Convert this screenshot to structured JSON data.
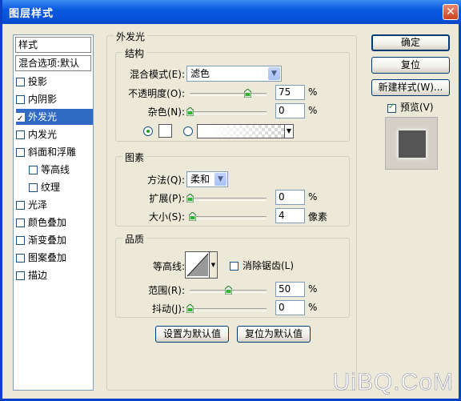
{
  "window": {
    "title": "图层样式"
  },
  "left_panel": {
    "header_styles": "样式",
    "header_blend": "混合选项:默认",
    "items": [
      {
        "label": "投影",
        "checked": false,
        "selected": false,
        "indent": false
      },
      {
        "label": "内阴影",
        "checked": false,
        "selected": false,
        "indent": false
      },
      {
        "label": "外发光",
        "checked": true,
        "selected": true,
        "indent": false
      },
      {
        "label": "内发光",
        "checked": false,
        "selected": false,
        "indent": false
      },
      {
        "label": "斜面和浮雕",
        "checked": false,
        "selected": false,
        "indent": false
      },
      {
        "label": "等高线",
        "checked": false,
        "selected": false,
        "indent": true
      },
      {
        "label": "纹理",
        "checked": false,
        "selected": false,
        "indent": true
      },
      {
        "label": "光泽",
        "checked": false,
        "selected": false,
        "indent": false
      },
      {
        "label": "颜色叠加",
        "checked": false,
        "selected": false,
        "indent": false
      },
      {
        "label": "渐变叠加",
        "checked": false,
        "selected": false,
        "indent": false
      },
      {
        "label": "图案叠加",
        "checked": false,
        "selected": false,
        "indent": false
      },
      {
        "label": "描边",
        "checked": false,
        "selected": false,
        "indent": false
      }
    ]
  },
  "main": {
    "section_title": "外发光",
    "structure": {
      "title": "结构",
      "blend_mode_label": "混合模式(E):",
      "blend_mode_value": "滤色",
      "opacity_label": "不透明度(O):",
      "opacity_value": "75",
      "opacity_unit": "%",
      "opacity_level": 0.75,
      "noise_label": "杂色(N):",
      "noise_value": "0",
      "noise_unit": "%",
      "noise_level": 0
    },
    "elements": {
      "title": "图素",
      "technique_label": "方法(Q):",
      "technique_value": "柔和",
      "spread_label": "扩展(P):",
      "spread_value": "0",
      "spread_unit": "%",
      "spread_level": 0,
      "size_label": "大小(S):",
      "size_value": "4",
      "size_unit": "像素",
      "size_level": 0.03
    },
    "quality": {
      "title": "品质",
      "contour_label": "等高线:",
      "antialias_label": "消除锯齿(L)",
      "range_label": "范围(R):",
      "range_value": "50",
      "range_unit": "%",
      "range_level": 0.5,
      "jitter_label": "抖动(J):",
      "jitter_value": "0",
      "jitter_unit": "%",
      "jitter_level": 0
    },
    "set_default_label": "设置为默认值",
    "reset_default_label": "复位为默认值"
  },
  "right_panel": {
    "ok_label": "确定",
    "reset_label": "复位",
    "new_style_label": "新建样式(W)...",
    "preview_label": "预览(V)",
    "preview_checked": true
  },
  "watermark": "UiBQ.CoM",
  "colors": {
    "selection": "#316ac5",
    "titlebar": "#0a59e0",
    "dialog_bg": "#ece9d8"
  }
}
